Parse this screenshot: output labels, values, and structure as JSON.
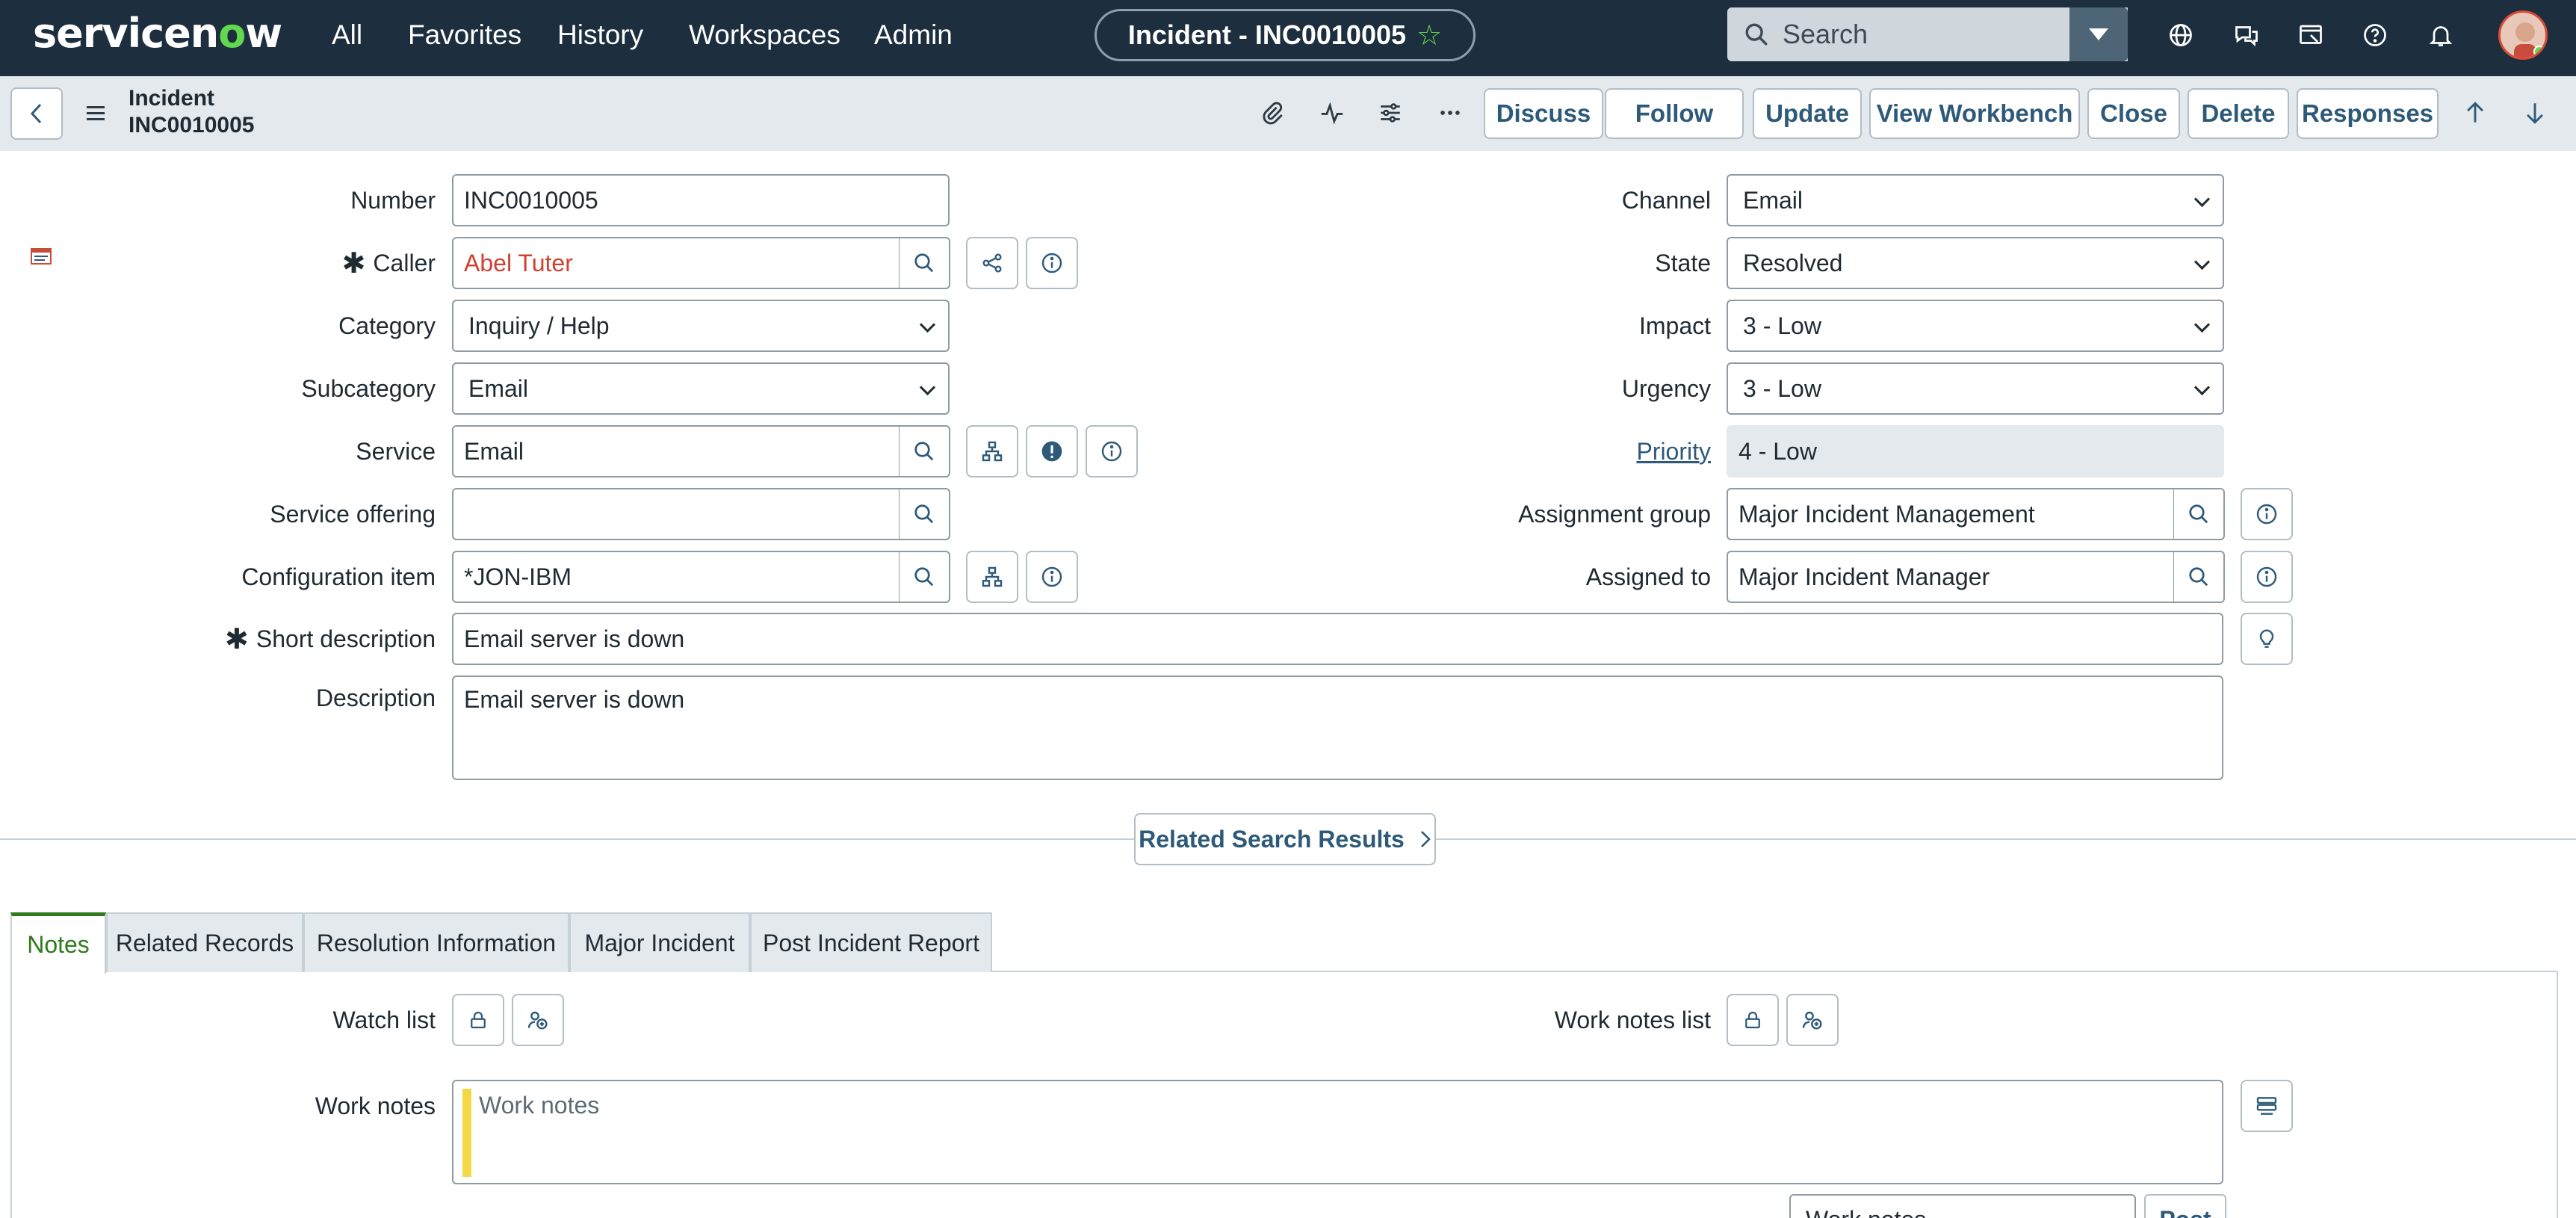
{
  "nav": {
    "logo_pre": "servicen",
    "logo_o": "o",
    "logo_post": "w",
    "links": [
      "All",
      "Favorites",
      "History",
      "Workspaces",
      "Admin"
    ],
    "context_title": "Incident - INC0010005",
    "search_placeholder": "Search"
  },
  "header": {
    "line1": "Incident",
    "line2": "INC0010005",
    "buttons": [
      "Discuss",
      "Follow",
      "Update",
      "View Workbench",
      "Close",
      "Delete",
      "Responses"
    ]
  },
  "form": {
    "number_label": "Number",
    "number_value": "INC0010005",
    "caller_label": "Caller",
    "caller_value": "Abel Tuter",
    "category_label": "Category",
    "category_value": "Inquiry / Help",
    "subcategory_label": "Subcategory",
    "subcategory_value": "Email",
    "service_label": "Service",
    "service_value": "Email",
    "service_offering_label": "Service offering",
    "service_offering_value": "",
    "ci_label": "Configuration item",
    "ci_value": "*JON-IBM",
    "short_desc_label": "Short description",
    "short_desc_value": "Email server is down",
    "description_label": "Description",
    "description_value": "Email server is down",
    "channel_label": "Channel",
    "channel_value": "Email",
    "state_label": "State",
    "state_value": "Resolved",
    "impact_label": "Impact",
    "impact_value": "3 - Low",
    "urgency_label": "Urgency",
    "urgency_value": "3 - Low",
    "priority_label": "Priority",
    "priority_value": "4 - Low",
    "assignment_group_label": "Assignment group",
    "assignment_group_value": "Major Incident Management",
    "assigned_to_label": "Assigned to",
    "assigned_to_value": "Major Incident Manager",
    "related_search_label": "Related Search Results"
  },
  "tabs": [
    "Notes",
    "Related Records",
    "Resolution Information",
    "Major Incident",
    "Post Incident Report"
  ],
  "notes": {
    "watch_list_label": "Watch list",
    "work_notes_list_label": "Work notes list",
    "work_notes_label": "Work notes",
    "work_notes_placeholder": "Work notes",
    "work_notes_select": "Work notes",
    "post_label": "Post"
  },
  "colors": {
    "nav_bg": "#1d2f3f",
    "accent_green": "#62d84e",
    "link_blue": "#2e5a7a",
    "caller_red": "#d0402e",
    "notes_yellow": "#f5d845"
  }
}
